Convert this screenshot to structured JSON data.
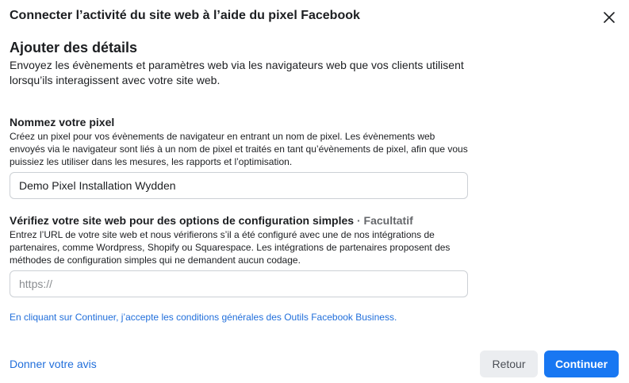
{
  "dialog": {
    "title": "Connecter l’activité du site web à l’aide du pixel Facebook",
    "close_icon": "close-icon"
  },
  "section": {
    "heading": "Ajouter des détails",
    "description": "Envoyez les évènements et paramètres web via les navigateurs web que vos clients utilisent lorsqu’ils interagissent avec votre site web."
  },
  "pixel_name": {
    "label": "Nommez votre pixel",
    "help": "Créez un pixel pour vos évènements de navigateur en entrant un nom de pixel. Les évènements web envoyés via le navigateur sont liés à un nom de pixel et traités en tant qu’évènements de pixel, afin que vous puissiez les utiliser dans les mesures, les rapports et l’optimisation.",
    "value": "Demo Pixel Installation Wydden"
  },
  "website": {
    "label": "Vérifiez votre site web pour des options de configuration simples",
    "optional": "· Facultatif",
    "help": "Entrez l’URL de votre site web et nous vérifierons s’il a été configuré avec une de nos intégrations de partenaires, comme Wordpress, Shopify ou Squarespace. Les intégrations de partenaires proposent des méthodes de configuration simples qui ne demandent aucun codage.",
    "value": "",
    "placeholder": "https://"
  },
  "terms_text": "En cliquant sur Continuer, j’accepte les conditions générales des Outils Facebook Business.",
  "footer": {
    "feedback_label": "Donner votre avis",
    "back_label": "Retour",
    "continue_label": "Continuer"
  },
  "colors": {
    "primary": "#1877f2",
    "link": "#216fdb",
    "secondary_bg": "#ebedf0",
    "input_border": "#ccd0d5"
  }
}
